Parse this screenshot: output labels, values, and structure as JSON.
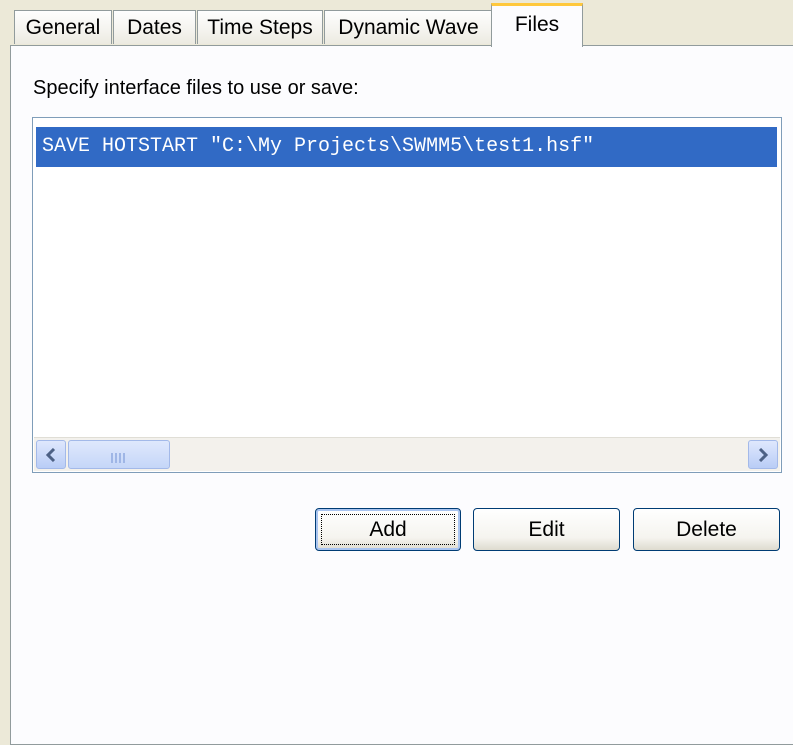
{
  "tabs": [
    {
      "label": "General"
    },
    {
      "label": "Dates"
    },
    {
      "label": "Time Steps"
    },
    {
      "label": "Dynamic Wave"
    },
    {
      "label": "Files"
    }
  ],
  "active_tab": "Files",
  "files_panel": {
    "prompt": "Specify interface files to use or save:",
    "list_items": [
      {
        "text": "SAVE HOTSTART \"C:\\My Projects\\SWMM5\\test1.hsf\"",
        "selected": true
      }
    ],
    "buttons": {
      "add": "Add",
      "edit": "Edit",
      "delete": "Delete"
    }
  },
  "colors": {
    "background": "#ece9d8",
    "selection": "#316ac5",
    "active_tab_accent": "#ffc83c",
    "button_border": "#003c74"
  }
}
